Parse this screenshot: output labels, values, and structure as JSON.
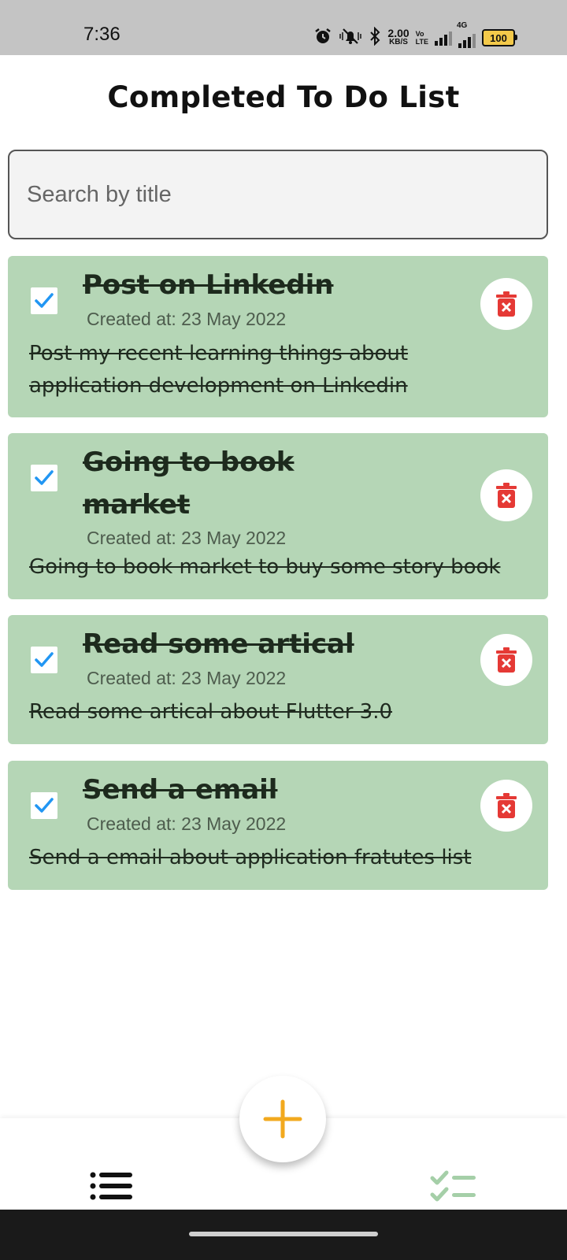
{
  "status_bar": {
    "time": "7:36",
    "speed_value": "2.00",
    "speed_unit": "KB/S",
    "volte_top": "Vo",
    "volte_bottom": "LTE",
    "network": "4G",
    "battery": "100"
  },
  "header": {
    "title": "Completed To Do List"
  },
  "search": {
    "placeholder": "Search by title",
    "value": ""
  },
  "todos": [
    {
      "title": "Post on Linkedin",
      "created": "Created at: 23 May 2022",
      "description": "Post my recent learning things about application development on Linkedin",
      "completed": true
    },
    {
      "title": "Going to book market",
      "created": "Created at: 23 May 2022",
      "description": "Going to book market to buy some story book",
      "completed": true
    },
    {
      "title": "Read some artical",
      "created": "Created at: 23 May 2022",
      "description": "Read some artical about Flutter 3.0",
      "completed": true
    },
    {
      "title": "Send a email",
      "created": "Created at: 23 May 2022",
      "description": "Send a email about application fratutes list",
      "completed": true
    }
  ],
  "icons": {
    "checkbox": "check-icon",
    "delete": "trash-icon",
    "fab": "plus-icon",
    "nav_left": "list-icon",
    "nav_right": "checklist-icon"
  },
  "colors": {
    "card_background": "#b5d6b6",
    "check_color": "#2196f3",
    "delete_color": "#e53935",
    "fab_plus": "#f2a91e",
    "nav_active": "#111111",
    "nav_inactive": "#a5cfa8"
  }
}
